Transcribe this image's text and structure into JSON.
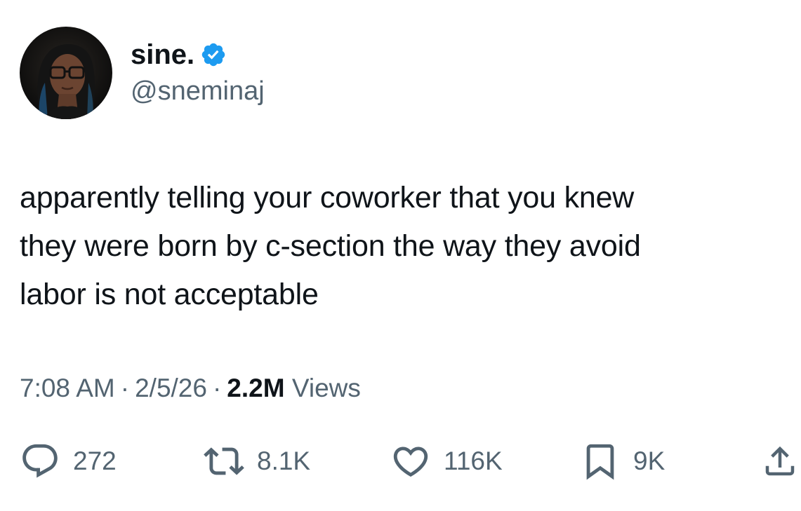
{
  "author": {
    "display_name": "sine.",
    "handle": "@sneminaj",
    "verified": true,
    "verified_color": "#1d9bf0",
    "avatar_icon": "profile-photo"
  },
  "tweet": {
    "text": "apparently telling your coworker that you knew\nthey were born by c-section the way they avoid\nlabor is not acceptable"
  },
  "meta": {
    "time": "7:08 AM",
    "separator": "·",
    "date": "2/5/26",
    "views_count": "2.2M",
    "views_label": "Views"
  },
  "actions": {
    "replies": "272",
    "reposts": "8.1K",
    "likes": "116K",
    "bookmarks": "9K"
  },
  "colors": {
    "text_primary": "#0f1419",
    "text_secondary": "#536471",
    "background": "#ffffff"
  }
}
